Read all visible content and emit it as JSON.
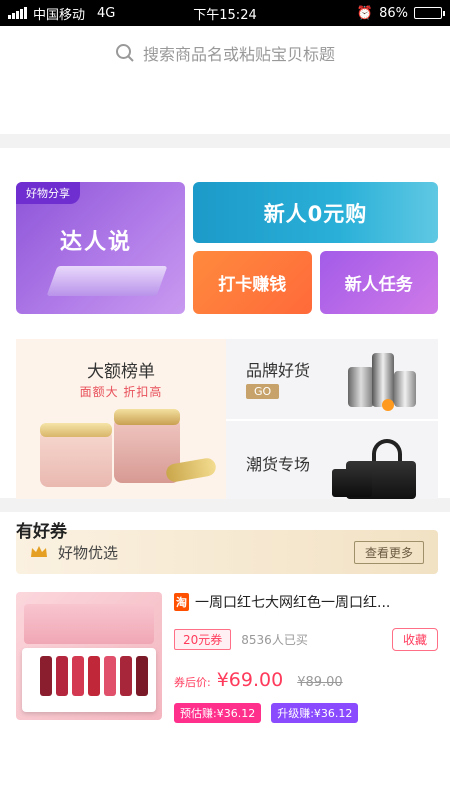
{
  "status_bar": {
    "carrier": "中国移动",
    "network": "4G",
    "time": "下午15:24",
    "battery": "86%",
    "battery_level": 0.86
  },
  "search": {
    "placeholder": "搜索商品名或粘贴宝贝标题"
  },
  "banners": {
    "daren": {
      "tag": "好物分享",
      "title": "达人说"
    },
    "xinren": {
      "title": "新人0元购"
    },
    "daka": {
      "title": "打卡赚钱"
    },
    "renwu": {
      "title": "新人任务"
    }
  },
  "promos": {
    "dae": {
      "title": "大额榜单",
      "subtitle": "面额大 折扣高"
    },
    "pinpai": {
      "title": "品牌好货",
      "badge": "GO"
    },
    "chaohuo": {
      "title": "潮货专场"
    }
  },
  "coupon_section": {
    "title": "有好券"
  },
  "goods_bar": {
    "title": "好物优选",
    "more": "查看更多"
  },
  "product": {
    "platform_tag": "淘",
    "title": "一周口红七大网红色一周口红...",
    "coupon": "20元券",
    "sold": "8536人已买",
    "fav": "收藏",
    "price_label": "券后价:",
    "price": "¥69.00",
    "original_price": "¥89.00",
    "estimate_earn": "预估赚:¥36.12",
    "upgrade_earn": "升级赚:¥36.12"
  }
}
